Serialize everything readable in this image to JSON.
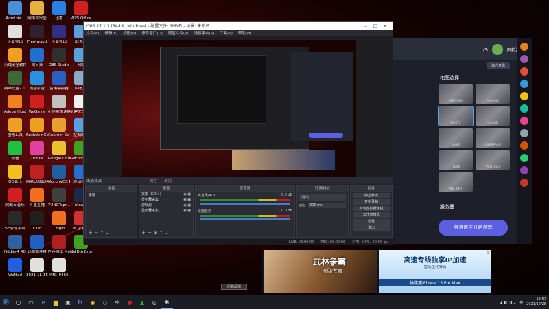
{
  "desktop": {
    "icons": [
      {
        "label": "Adminis...",
        "color": "#4a90d9"
      },
      {
        "label": "网络和安全",
        "color": "#e8b040"
      },
      {
        "label": "迅雷",
        "color": "#2a80e0"
      },
      {
        "label": "WPS Office",
        "color": "#d02020"
      },
      {
        "label": "专业导出",
        "color": "#e0e0e0"
      },
      {
        "label": "Fleetwood",
        "color": "#302030"
      },
      {
        "label": "专业导出",
        "color": "#303080"
      },
      {
        "label": "此电脑",
        "color": "#5aa0e0"
      },
      {
        "label": "火绒安全软件",
        "color": "#f0a020"
      },
      {
        "label": "向日葵",
        "color": "#2070d0"
      },
      {
        "label": "OBS Studio",
        "color": "#303030"
      },
      {
        "label": "网络",
        "color": "#5aa0e0"
      },
      {
        "label": "英雄联盟2.0 Pooliam",
        "color": "#3a6a3a"
      },
      {
        "label": "迅雷影音",
        "color": "#2a90e0"
      },
      {
        "label": "雷电模拟器",
        "color": "#2a60c0"
      },
      {
        "label": "回收站",
        "color": "#88aacc"
      },
      {
        "label": "Adobe Illustrat...",
        "color": "#f08020"
      },
      {
        "label": "WeGame",
        "color": "#d02020"
      },
      {
        "label": "小黑盒加速器",
        "color": "#c0c0c0"
      },
      {
        "label": "新建文本文档",
        "color": "#f0f0f0"
      },
      {
        "label": "图吧工具",
        "color": "#f0a020"
      },
      {
        "label": "Rockstar Games...",
        "color": "#f0a020"
      },
      {
        "label": "Counter-Str Global Off...",
        "color": "#e8a030"
      },
      {
        "label": "控制面板",
        "color": "#5aa0e0"
      },
      {
        "label": "微信",
        "color": "#20c040"
      },
      {
        "label": "iTunes",
        "color": "#e040a0"
      },
      {
        "label": "Google Chrome",
        "color": "#e8c030"
      },
      {
        "label": "GeForce Experience",
        "color": "#40a020"
      },
      {
        "label": "QQ音乐",
        "color": "#f0c020"
      },
      {
        "label": "网易UU加速器",
        "color": "#c02020"
      },
      {
        "label": "MorphVOX Pro",
        "color": "#2060a0"
      },
      {
        "label": "驱动总裁",
        "color": "#2070d0"
      },
      {
        "label": "网易云音乐",
        "color": "#d02020"
      },
      {
        "label": "斗鱼直播",
        "color": "#f07020"
      },
      {
        "label": "YUNGTopr...",
        "color": "#404040"
      },
      {
        "label": "steam",
        "color": "#1a2a4a"
      },
      {
        "label": "5E对战平台",
        "color": "#2a2a2a"
      },
      {
        "label": "iCUE",
        "color": "#202020"
      },
      {
        "label": "Origin",
        "color": "#f07020"
      },
      {
        "label": "红色警戒",
        "color": "#d03030"
      },
      {
        "label": "Fiddler4 ROG Edit...",
        "color": "#3060a0"
      },
      {
        "label": "迅游加速器",
        "color": "#2060c0"
      },
      {
        "label": "内存测试 MemTest...",
        "color": "#b02020"
      },
      {
        "label": "NVIDIA Broadcast",
        "color": "#40a020"
      },
      {
        "label": "WeMod",
        "color": "#2060e0"
      },
      {
        "label": "2021-11-15 23-09-57",
        "color": "#e0e0e0"
      },
      {
        "label": "IMG_9466",
        "color": "#e0e0e0"
      }
    ]
  },
  "obs": {
    "title": "OBS 27.1.3 (64-bit, windows) - 配置文件: 未命名 - 场景: 未命名",
    "menu": [
      "文件(F)",
      "编辑(E)",
      "视图(V)",
      "停靠窗口(D)",
      "配置文件(P)",
      "场景集合(S)",
      "工具(T)",
      "帮助(H)"
    ],
    "preview_label": "未选择源",
    "toolbar": {
      "properties": "属性",
      "filters": "滤镜"
    },
    "panels": {
      "scenes": {
        "title": "场景",
        "items": [
          "场景"
        ]
      },
      "sources": {
        "title": "来源",
        "items": [
          "文本 (GDI+)",
          "显示器采集",
          "游戏源",
          "显示器采集"
        ]
      },
      "mixer": {
        "title": "混音器",
        "tracks": [
          {
            "name": "麦克风/Aux",
            "db": "0.0 dB"
          },
          {
            "name": "桌面音频",
            "db": "0.0 dB"
          }
        ]
      },
      "transitions": {
        "title": "转场特效",
        "type": "淡出",
        "duration_label": "时长",
        "duration": "300 ms"
      },
      "controls": {
        "title": "控件",
        "buttons": [
          "停止推流",
          "开始录制",
          "启动虚拟摄像机",
          "工作室模式",
          "设置",
          "退出"
        ]
      }
    },
    "status": {
      "live": "LIVE: 00:00:00",
      "rec": "REC: 00:00:00",
      "cpu": "CPU: 0.9%, 60.00 fps"
    }
  },
  "lobby": {
    "user_name": "阿药兰梅",
    "invite_label": "邀人开黑",
    "map_section": "地图选择",
    "maps": [
      "INFERNO",
      "MIRAGE",
      "DUST2",
      "CACHE",
      "NUKE",
      "OVERPASS",
      "TRAIN",
      "VERTIGO",
      "ANCIENT"
    ],
    "server_section": "服务器",
    "start_button": "等待房主开启游戏"
  },
  "ad": {
    "left_title": "武林争霸",
    "left_sub": "一剑破苍穹",
    "right_title": "高速专线独享IP加速",
    "right_sub": "活动正式开启",
    "right_foot": "抽奖赢iPhone 13 Pro Max",
    "close_label": "问题反馈",
    "ad_tag": "广告"
  },
  "taskbar": {
    "time": "18:57",
    "date": "2021/12/28",
    "lang": "英"
  }
}
